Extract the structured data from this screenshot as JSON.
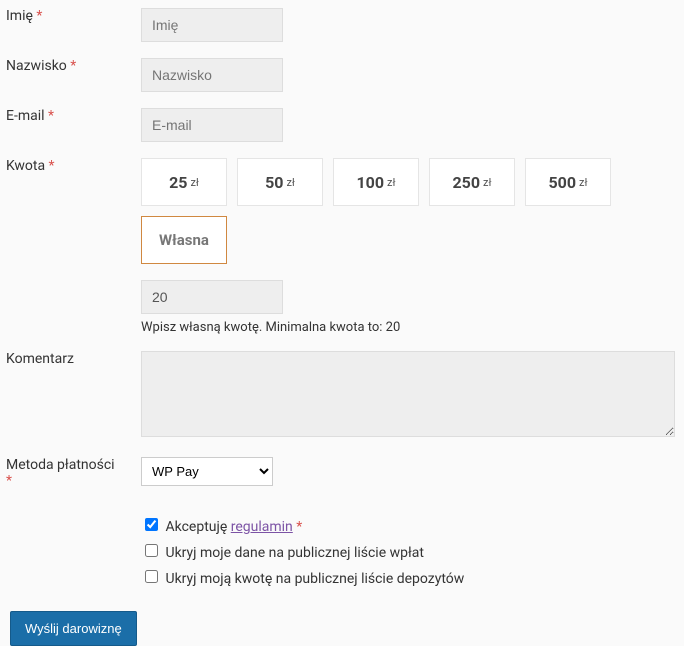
{
  "labels": {
    "firstname": "Imię",
    "lastname": "Nazwisko",
    "email": "E-mail",
    "amount": "Kwota",
    "comment": "Komentarz",
    "payment_method": "Metoda płatności"
  },
  "placeholders": {
    "firstname": "Imię",
    "lastname": "Nazwisko",
    "email": "E-mail"
  },
  "amounts": {
    "currency": "zł",
    "options": [
      "25",
      "50",
      "100",
      "250",
      "500"
    ],
    "custom_label": "Własna",
    "custom_value": "20",
    "helper": "Wpisz własną kwotę. Minimalna kwota to: 20"
  },
  "payment": {
    "selected": "WP Pay"
  },
  "checks": {
    "accept_prefix": "Akceptuję ",
    "terms_link": "regulamin",
    "hide_name": "Ukryj moje dane na publicznej liście wpłat",
    "hide_amount": "Ukryj moją kwotę na publicznej liście depozytów"
  },
  "submit": "Wyślij darowiznę"
}
